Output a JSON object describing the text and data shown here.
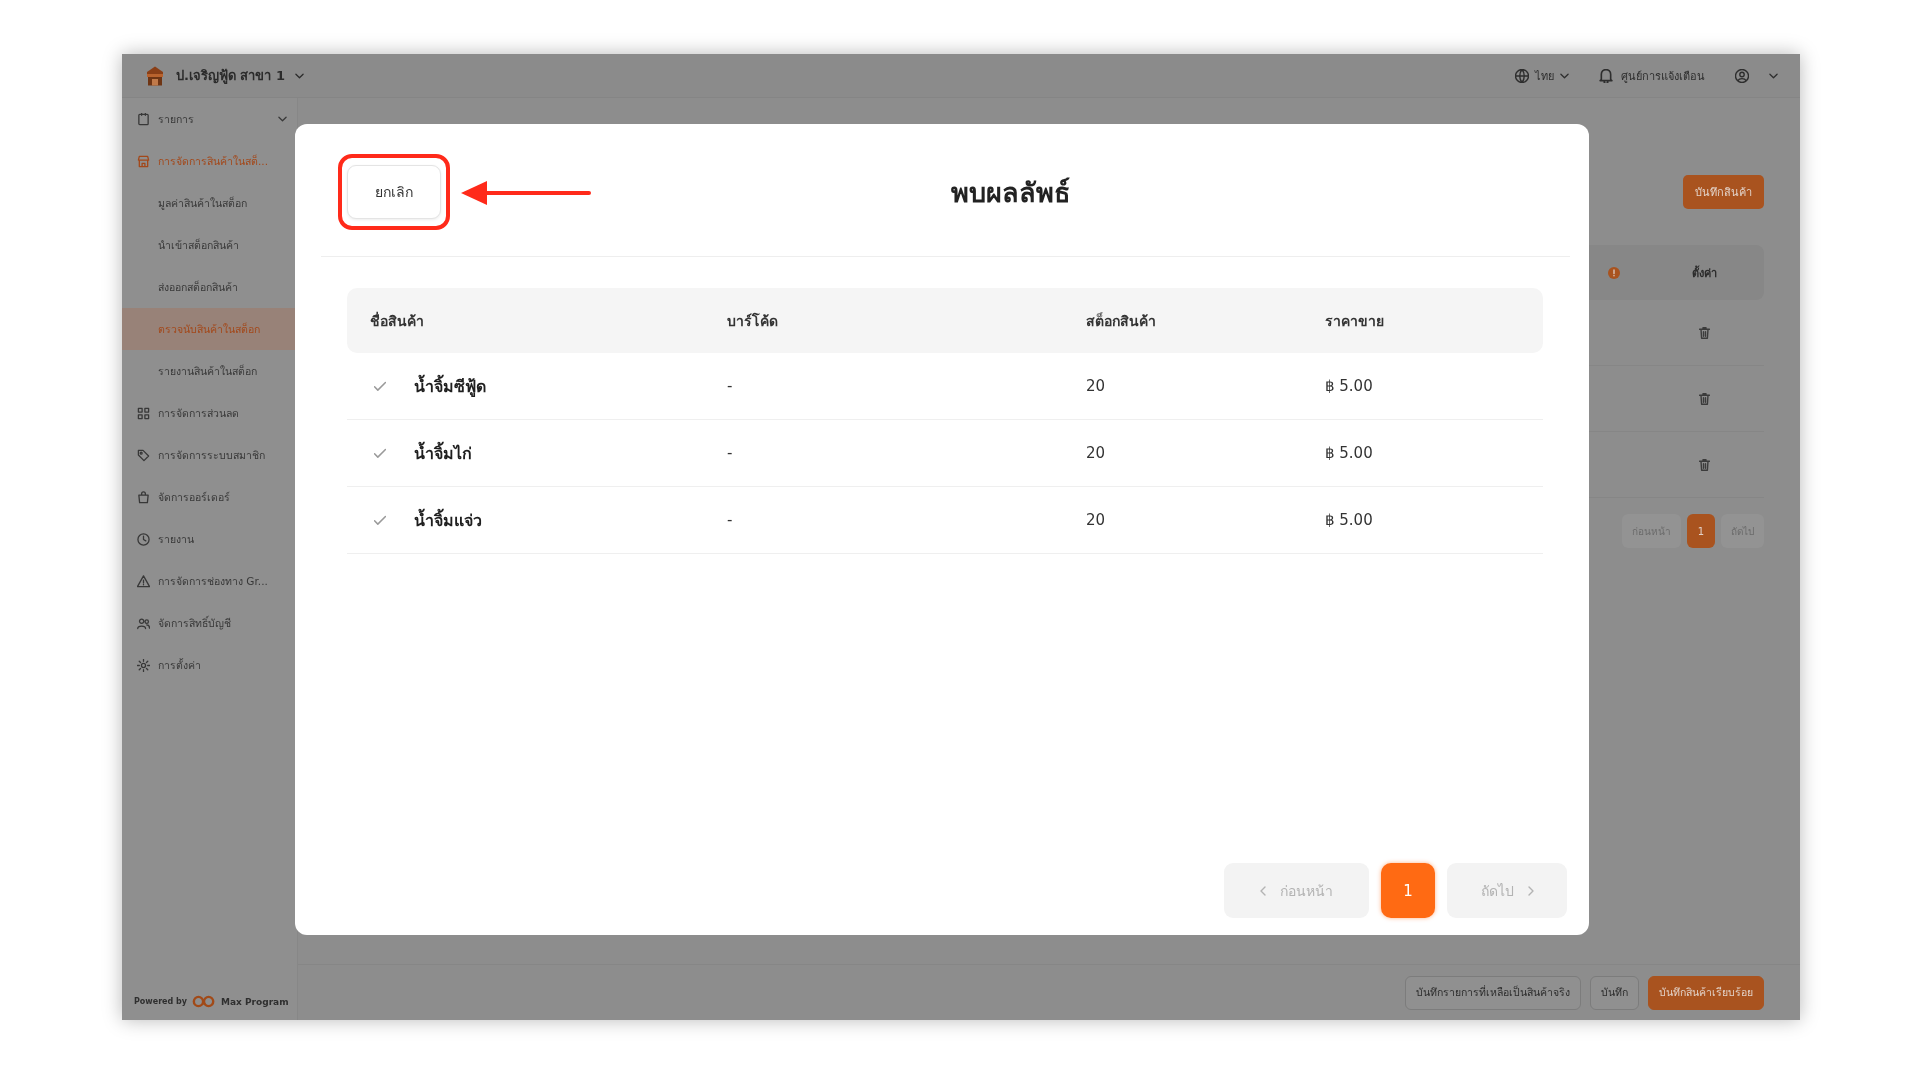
{
  "app_header": {
    "branch": "ป.เจริญฟู้ด สาขา 1",
    "language": "ไทย",
    "notification_center": "ศูนย์การแจ้งเตือน"
  },
  "sidebar": {
    "items": [
      {
        "label": "รายการ",
        "kind": "group",
        "expanded": false,
        "selected": false
      },
      {
        "label": "การจัดการสินค้าในสต็...",
        "kind": "group",
        "expanded": true,
        "selected": true,
        "children": [
          {
            "label": "มูลค่าสินค้าในสต็อก",
            "selected": false
          },
          {
            "label": "นำเข้าสต็อกสินค้า",
            "selected": false
          },
          {
            "label": "ส่งออกสต็อกสินค้า",
            "selected": false
          },
          {
            "label": "ตรวจนับสินค้าในสต็อก",
            "selected": true
          },
          {
            "label": "รายงานสินค้าในสต็อก",
            "selected": false
          }
        ]
      },
      {
        "label": "การจัดการส่วนลด",
        "kind": "link",
        "selected": false
      },
      {
        "label": "การจัดการระบบสมาชิก",
        "kind": "link",
        "selected": false
      },
      {
        "label": "จัดการออร์เดอร์",
        "kind": "link",
        "selected": false
      },
      {
        "label": "รายงาน",
        "kind": "link",
        "selected": false
      },
      {
        "label": "การจัดการช่องทาง Gr...",
        "kind": "link",
        "selected": false
      },
      {
        "label": "จัดการสิทธิ์บัญชี",
        "kind": "link",
        "selected": false
      },
      {
        "label": "การตั้งค่า",
        "kind": "link",
        "selected": false
      }
    ],
    "footer": {
      "powered_by": "Powered by",
      "brand": "Max Program"
    }
  },
  "page": {
    "save_product_button": "บันทึกสินค้า",
    "table": {
      "settings_column": "ตั้งค่า",
      "rows": [
        {
          "deletable": true
        },
        {
          "deletable": true
        },
        {
          "deletable": true
        }
      ]
    },
    "pagination": {
      "previous": {
        "label": "ก่อนหน้า",
        "disabled": true
      },
      "pages": [
        {
          "label": "1",
          "selected": true
        }
      ],
      "next": {
        "label": "ถัดไป",
        "disabled": true
      }
    },
    "footer_buttons": [
      {
        "label": "บันทึกรายการที่เหลือเป็นสินค้าจริง",
        "kind": "outline"
      },
      {
        "label": "บันทึก",
        "kind": "outline"
      },
      {
        "label": "บันทึกสินค้าเรียบร้อย",
        "kind": "primary"
      }
    ]
  },
  "modal": {
    "cancel_button": {
      "label": "ยกเลิก",
      "highlighted": true,
      "pointed_by_arrow": true
    },
    "title": "พบผลลัพธ์",
    "table": {
      "columns": [
        "ชื่อสินค้า",
        "บาร์โค้ด",
        "สต็อกสินค้า",
        "ราคาขาย"
      ],
      "rows": [
        {
          "checked": true,
          "name": "น้ำจิ้มซีฟู้ด",
          "barcode": "-",
          "stock": "20",
          "price": "฿ 5.00"
        },
        {
          "checked": true,
          "name": "น้ำจิ้มไก่",
          "barcode": "-",
          "stock": "20",
          "price": "฿ 5.00"
        },
        {
          "checked": true,
          "name": "น้ำจิ้มแจ่ว",
          "barcode": "-",
          "stock": "20",
          "price": "฿ 5.00"
        }
      ]
    },
    "pagination": {
      "previous": {
        "label": "ก่อนหน้า",
        "disabled": true
      },
      "pages": [
        {
          "label": "1",
          "selected": true
        }
      ],
      "next": {
        "label": "ถัดไป",
        "disabled": true
      }
    }
  }
}
